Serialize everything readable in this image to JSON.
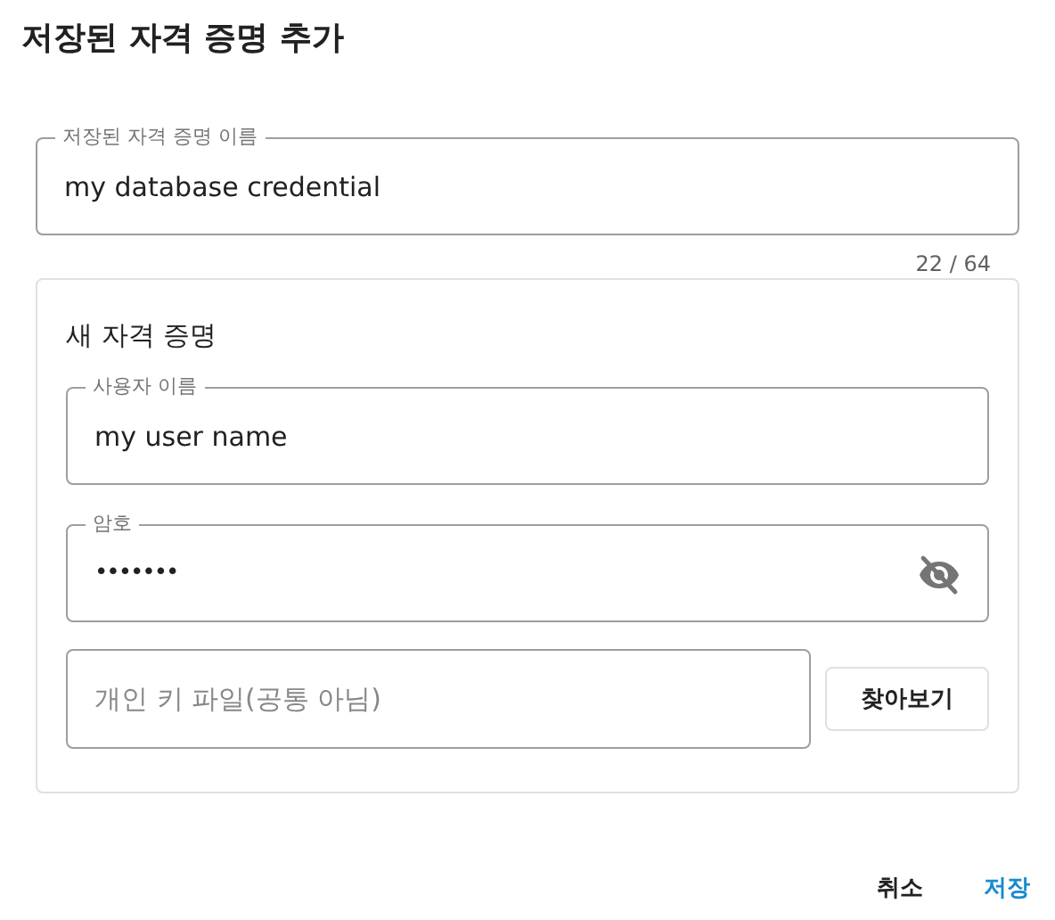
{
  "dialog": {
    "title": "저장된 자격 증명 추가"
  },
  "name_field": {
    "label": "저장된 자격 증명 이름",
    "value": "my database credential",
    "counter": "22 / 64"
  },
  "credential_card": {
    "title": "새 자격 증명",
    "username": {
      "label": "사용자 이름",
      "value": "my user name"
    },
    "password": {
      "label": "암호",
      "value": "•••••••",
      "visible": false
    },
    "key_file": {
      "placeholder": "개인 키 파일(공통 아님)",
      "browse_button": "찾아보기"
    }
  },
  "buttons": [
    {
      "label": "취소",
      "kind": "secondary"
    },
    {
      "label": "저장",
      "kind": "primary"
    }
  ]
}
